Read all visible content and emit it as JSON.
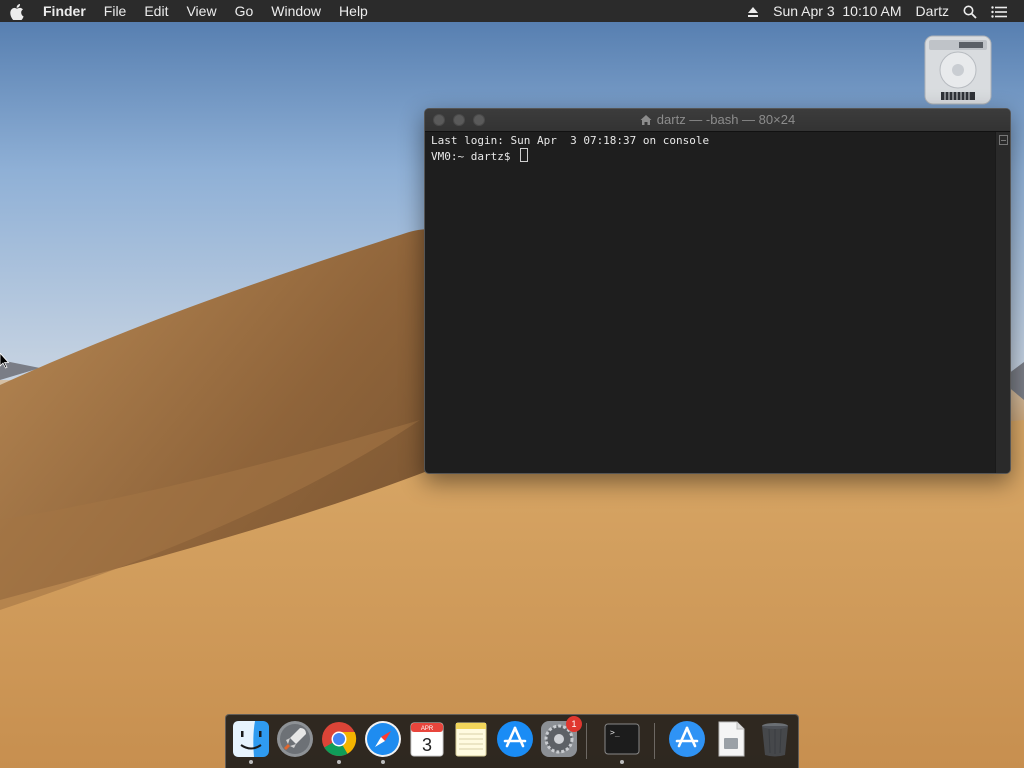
{
  "menubar": {
    "apple_icon": "apple-logo-icon",
    "app_name": "Finder",
    "items": [
      "File",
      "Edit",
      "View",
      "Go",
      "Window",
      "Help"
    ],
    "clock": "Sun Apr 3  10:10 AM",
    "user": "Dartz",
    "status_icons": [
      "eject-icon",
      "spotlight-search-icon",
      "notification-center-icon"
    ]
  },
  "desktop": {
    "icons": [
      {
        "name": "hard-drive-icon"
      }
    ]
  },
  "terminal": {
    "title": "dartz — -bash — 80×24",
    "lines": [
      "Last login: Sun Apr  3 07:18:37 on console",
      "VM0:~ dartz$ "
    ]
  },
  "dock": {
    "calendar_month": "APR",
    "calendar_day": "3",
    "system_preferences_badge": "1",
    "terminal_prompt": ">_",
    "items": [
      "finder-icon",
      "launchpad-icon",
      "chrome-icon",
      "safari-icon",
      "calendar-icon",
      "notes-icon",
      "app-store-icon",
      "system-preferences-icon",
      "terminal-icon",
      "app-store-downloads-icon",
      "document-icon",
      "trash-icon"
    ]
  }
}
